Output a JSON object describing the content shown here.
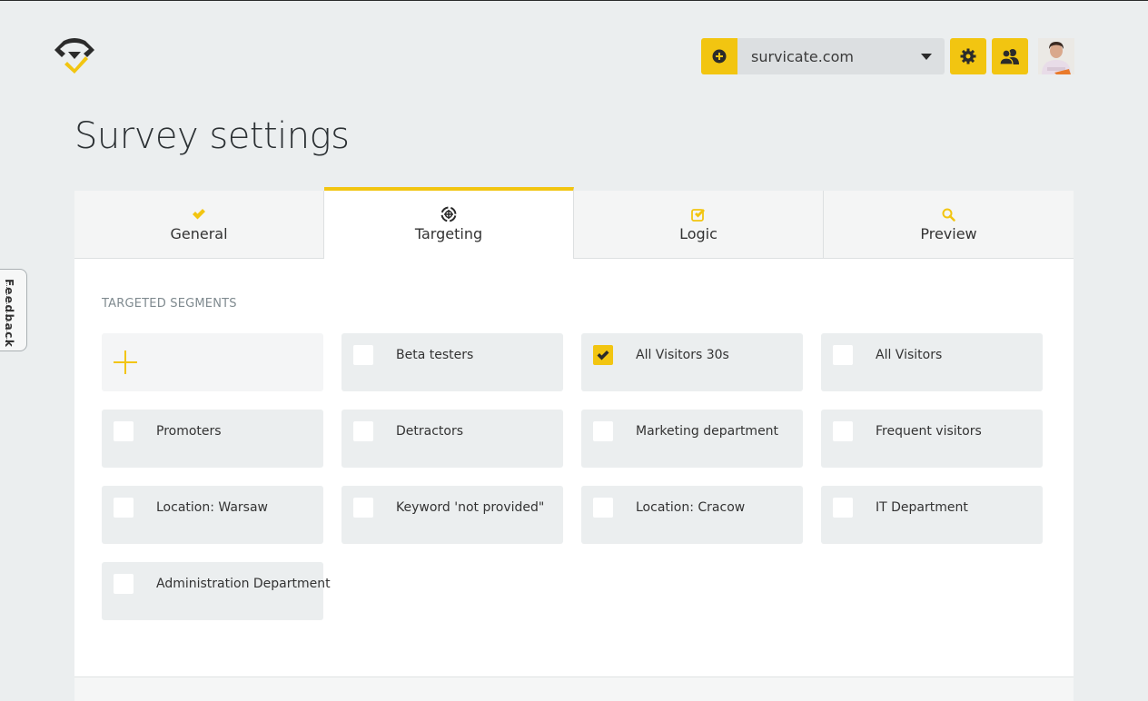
{
  "brand": {
    "logo": "survicate-logo",
    "accent_color": "#f2c511"
  },
  "header": {
    "add_site_icon": "plus-circle-icon",
    "site_selector": {
      "value": "survicate.com",
      "icon": "caret-down-icon"
    },
    "settings_icon": "gear-icon",
    "team_icon": "users-icon",
    "avatar": "user-avatar"
  },
  "page": {
    "title": "Survey settings"
  },
  "tabs": [
    {
      "label": "General",
      "icon": "check-icon",
      "active": false
    },
    {
      "label": "Targeting",
      "icon": "crosshair-icon",
      "active": true
    },
    {
      "label": "Logic",
      "icon": "checkbox-icon",
      "active": false
    },
    {
      "label": "Preview",
      "icon": "search-icon",
      "active": false
    }
  ],
  "targeting": {
    "section_label": "TARGETED SEGMENTS",
    "add_icon": "plus-icon",
    "segments": [
      {
        "label": "Beta testers",
        "checked": false
      },
      {
        "label": "All Visitors 30s",
        "checked": true
      },
      {
        "label": "All Visitors",
        "checked": false
      },
      {
        "label": "Promoters",
        "checked": false
      },
      {
        "label": "Detractors",
        "checked": false
      },
      {
        "label": "Marketing department",
        "checked": false
      },
      {
        "label": "Frequent visitors",
        "checked": false
      },
      {
        "label": "Location: Warsaw",
        "checked": false
      },
      {
        "label": "Keyword 'not provided\"",
        "checked": false
      },
      {
        "label": "Location: Cracow",
        "checked": false
      },
      {
        "label": "IT Department",
        "checked": false
      },
      {
        "label": "Administration Department",
        "checked": false
      }
    ]
  },
  "feedback_tab": {
    "label": "Feedback"
  }
}
